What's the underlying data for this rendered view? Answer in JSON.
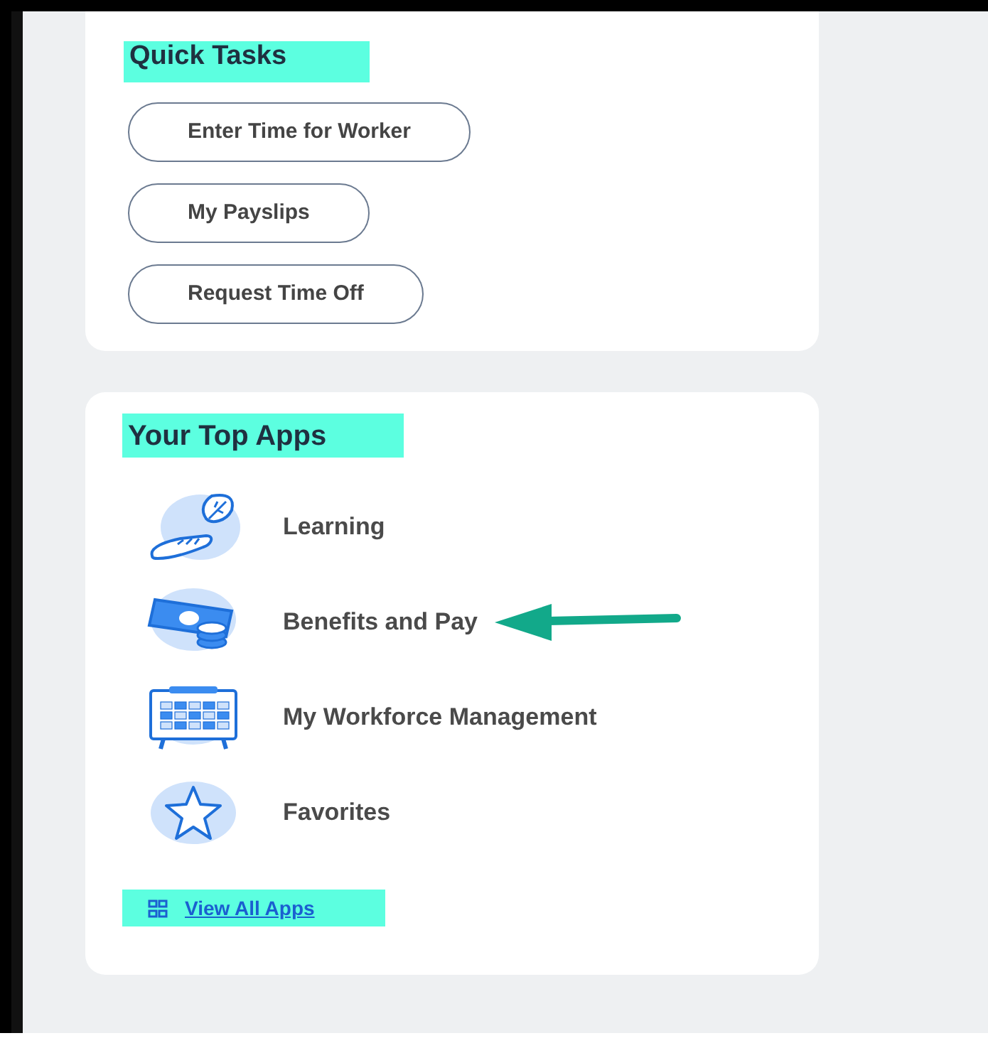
{
  "quick_tasks": {
    "title": "Quick Tasks",
    "buttons": [
      "Enter Time for Worker",
      "My Payslips",
      "Request Time Off"
    ]
  },
  "top_apps": {
    "title": "Your Top Apps",
    "apps": [
      {
        "kind": "learning",
        "label": "Learning",
        "arrow": false
      },
      {
        "kind": "pay",
        "label": "Benefits and Pay",
        "arrow": true
      },
      {
        "kind": "calendar",
        "label": "My Workforce Management",
        "arrow": false
      },
      {
        "kind": "star",
        "label": "Favorites",
        "arrow": false
      }
    ],
    "view_all": "View All Apps"
  }
}
